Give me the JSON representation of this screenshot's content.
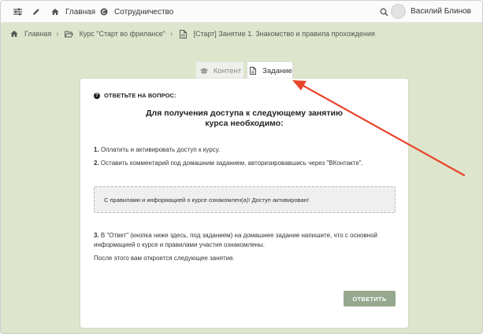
{
  "topbar": {
    "home_label": "Главная",
    "collab_label": "Сотрудничество",
    "user_name": "Василий Блинов"
  },
  "breadcrumb": {
    "home": "Главная",
    "course": "Курс \"Старт во фрилансе\"",
    "lesson": "[Старт] Занятие 1. Знакомство и правила прохождения"
  },
  "tabs": {
    "content": "Контент",
    "task": "Задание"
  },
  "task": {
    "question_heading": "ОТВЕТЬТЕ НА ВОПРОС:",
    "title_line1": "Для получения доступа к следующему занятию",
    "title_line2": "курса необходимо:",
    "step1_num": "1.",
    "step1_text": " Оплатить и активировать доступ к курсу.",
    "step2_num": "2.",
    "step2_text": " Оставить комментарий под домашним заданием, авторизировавшись через \"ВКонтакте\".",
    "notice": "С правилами и информацией о курсе ознакомлен(а)! Доступ активирован!",
    "step3_num": "3.",
    "step3_text": " В \"Ответ\" (кнопка ниже здесь, под заданием) на домашнее задание напишите, что с основной информацией о курсе и правилами участия ознакомлены.",
    "after_text": "После этого вам откроется следующее занятие.",
    "answer_button": "ОТВЕТИТЬ"
  },
  "colors": {
    "background": "#dde5cc",
    "button": "#96a88d",
    "arrow": "#e8442a"
  },
  "icons": [
    "sliders-icon",
    "pencil-icon",
    "home-icon",
    "copyright-icon",
    "search-icon",
    "folder-open-icon",
    "file-icon",
    "graduation-cap-icon",
    "question-circle-icon"
  ]
}
